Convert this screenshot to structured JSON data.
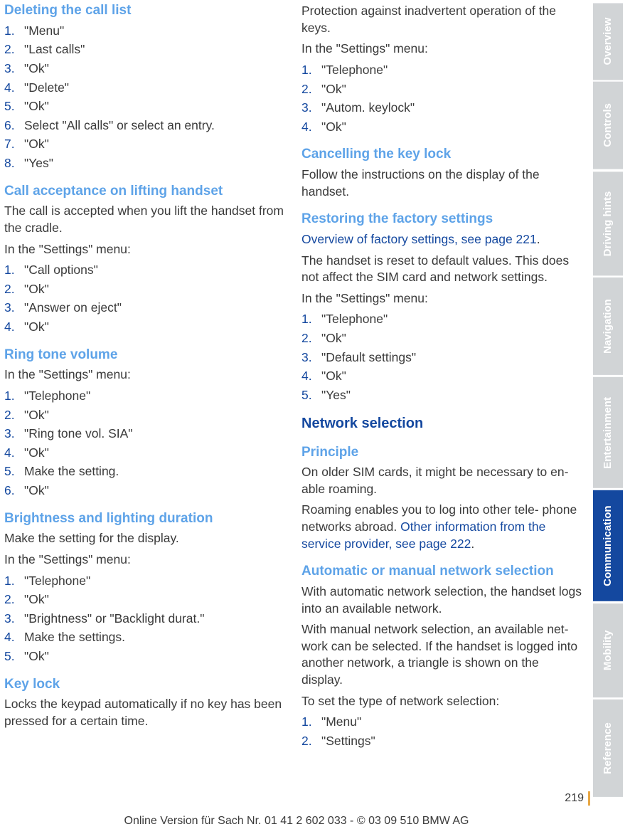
{
  "tabs": {
    "overview": "Overview",
    "controls": "Controls",
    "driving": "Driving hints",
    "navigation": "Navigation",
    "entertain": "Entertainment",
    "comm": "Communication",
    "mobility": "Mobility",
    "reference": "Reference"
  },
  "left": {
    "h_delete": "Deleting the call list",
    "delete_steps": [
      "\"Menu\"",
      "\"Last calls\"",
      "\"Ok\"",
      "\"Delete\"",
      "\"Ok\"",
      "Select \"All calls\" or select an entry.",
      "\"Ok\"",
      "\"Yes\""
    ],
    "h_accept": "Call acceptance on lifting handset",
    "accept_p1": "The call is accepted when you lift the handset from the cradle.",
    "accept_p2": "In the \"Settings\" menu:",
    "accept_steps": [
      "\"Call options\"",
      "\"Ok\"",
      "\"Answer on eject\"",
      "\"Ok\""
    ],
    "h_ring": "Ring tone volume",
    "ring_p": "In the \"Settings\" menu:",
    "ring_steps": [
      "\"Telephone\"",
      "\"Ok\"",
      "\"Ring tone vol. SIA\"",
      "\"Ok\"",
      "Make the setting.",
      "\"Ok\""
    ],
    "h_bright": "Brightness and lighting duration",
    "bright_p1": "Make the setting for the display.",
    "bright_p2": "In the \"Settings\" menu:",
    "bright_steps": [
      "\"Telephone\"",
      "\"Ok\"",
      "\"Brightness\" or \"Backlight durat.\"",
      "Make the settings.",
      "\"Ok\""
    ],
    "h_keylock": "Key lock",
    "keylock_p": "Locks the keypad automatically if no key has been pressed for a certain time."
  },
  "right": {
    "prot_p1": "Protection against inadvertent operation of the keys.",
    "prot_p2": "In the \"Settings\" menu:",
    "prot_steps": [
      "\"Telephone\"",
      "\"Ok\"",
      "\"Autom. keylock\"",
      "\"Ok\""
    ],
    "h_cancel": "Cancelling the key lock",
    "cancel_p": "Follow the instructions on the display of the handset.",
    "h_restore": "Restoring the factory settings",
    "restore_link": "Overview of factory settings, see page 221",
    "restore_dot": ".",
    "restore_p1": "The handset is reset to default values. This does not affect the SIM card and network settings.",
    "restore_p2": "In the \"Settings\" menu:",
    "restore_steps": [
      "\"Telephone\"",
      "\"Ok\"",
      "\"Default settings\"",
      "\"Ok\"",
      "\"Yes\""
    ],
    "h_network": "Network selection",
    "h_principle": "Principle",
    "principle_p1": "On older SIM cards, it might be necessary to en‐ able roaming.",
    "principle_p2a": "Roaming enables you to log into other tele‐ phone networks abroad. ",
    "principle_link": "Other information from the service provider, see page 222",
    "principle_dot": ".",
    "h_autonet": "Automatic or manual network selection",
    "autonet_p1": "With automatic network selection, the handset logs into an available network.",
    "autonet_p2": "With manual network selection, an available net‐ work can be selected. If the handset is logged into another network, a triangle is shown on the display.",
    "autonet_p3": "To set the type of network selection:",
    "autonet_steps": [
      "\"Menu\"",
      "\"Settings\""
    ]
  },
  "pagenum": "219",
  "footer": "Online Version für Sach Nr. 01 41 2 602 033 - © 03 09 510 BMW AG"
}
